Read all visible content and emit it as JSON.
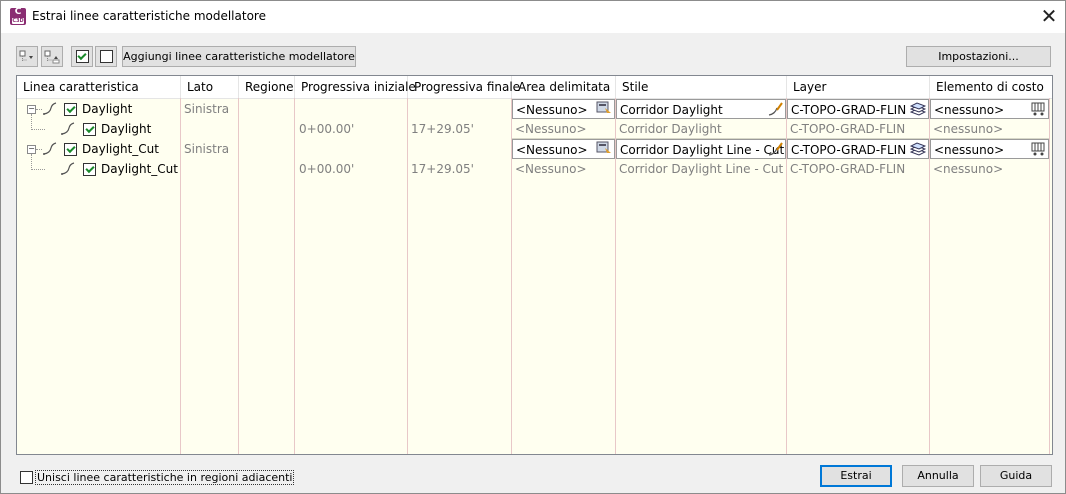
{
  "window": {
    "title": "Estrai linee caratteristiche modellatore",
    "app_icon_letter": "C",
    "app_icon_sub": "C3D"
  },
  "toolbar": {
    "add_button_label": "Aggiungi linee caratteristiche modellatore",
    "settings_button_label": "Impostazioni..."
  },
  "table": {
    "columns": [
      "Linea caratteristica",
      "Lato",
      "Regione",
      "Progressiva iniziale",
      "Progressiva finale",
      "Area delimitata",
      "Stile",
      "Layer",
      "Elemento di costo"
    ],
    "rows": [
      {
        "level": 0,
        "name": "Daylight",
        "checked": true,
        "side": "Sinistra",
        "start": "",
        "end": "",
        "area": "<Nessuno>",
        "style": "Corridor Daylight",
        "layer": "C-TOPO-GRAD-FLIN",
        "cost": "<nessuno>"
      },
      {
        "level": 1,
        "name": "Daylight",
        "checked": true,
        "side": "",
        "start": "0+00.00'",
        "end": "17+29.05'",
        "area": "<Nessuno>",
        "style": "Corridor Daylight",
        "layer": "C-TOPO-GRAD-FLIN",
        "cost": "<nessuno>"
      },
      {
        "level": 0,
        "name": "Daylight_Cut",
        "checked": true,
        "side": "Sinistra",
        "start": "",
        "end": "",
        "area": "<Nessuno>",
        "style": "Corridor Daylight Line - Cut",
        "layer": "C-TOPO-GRAD-FLIN",
        "cost": "<nessuno>"
      },
      {
        "level": 1,
        "name": "Daylight_Cut",
        "checked": true,
        "side": "",
        "start": "0+00.00'",
        "end": "17+29.05'",
        "area": "<Nessuno>",
        "style": "Corridor Daylight Line - Cut",
        "layer": "C-TOPO-GRAD-FLIN",
        "cost": "<nessuno>"
      }
    ]
  },
  "footer": {
    "merge_label": "Unisci linee caratteristiche in regioni adiacenti",
    "merge_checked": false,
    "extract_label": "Estrai",
    "cancel_label": "Annulla",
    "help_label": "Guida"
  },
  "colors": {
    "grid_bg": "#fffff0",
    "accent": "#0078d7",
    "app_icon": "#8a2d72"
  }
}
